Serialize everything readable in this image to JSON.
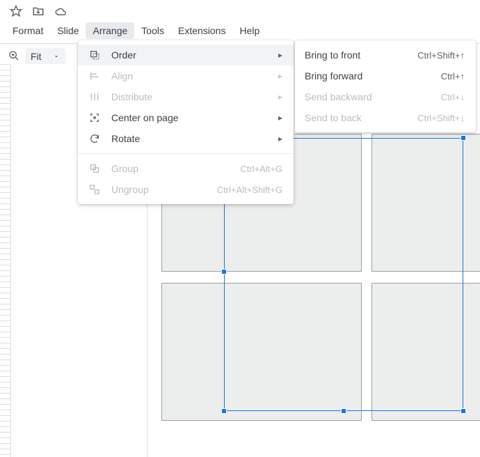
{
  "title_icons": [
    "star",
    "move-to-folder",
    "cloud"
  ],
  "menubar": {
    "items": [
      "Format",
      "Slide",
      "Arrange",
      "Tools",
      "Extensions",
      "Help"
    ],
    "open_index": 2
  },
  "toolbar": {
    "zoom_label": "Fit"
  },
  "arrange_menu": {
    "items": [
      {
        "icon": "order",
        "label": "Order",
        "submenu": true,
        "enabled": true,
        "hover": true
      },
      {
        "icon": "align",
        "label": "Align",
        "submenu": true,
        "enabled": false
      },
      {
        "icon": "distribute",
        "label": "Distribute",
        "submenu": true,
        "enabled": false
      },
      {
        "icon": "center",
        "label": "Center on page",
        "submenu": true,
        "enabled": true
      },
      {
        "icon": "rotate",
        "label": "Rotate",
        "submenu": true,
        "enabled": true
      },
      {
        "separator": true
      },
      {
        "icon": "group",
        "label": "Group",
        "kbd": "Ctrl+Alt+G",
        "enabled": false
      },
      {
        "icon": "ungroup",
        "label": "Ungroup",
        "kbd": "Ctrl+Alt+Shift+G",
        "enabled": false
      }
    ]
  },
  "order_submenu": {
    "items": [
      {
        "label": "Bring to front",
        "kbd": "Ctrl+Shift+↑",
        "enabled": true,
        "highlighted": true
      },
      {
        "label": "Bring forward",
        "kbd": "Ctrl+↑",
        "enabled": true
      },
      {
        "label": "Send backward",
        "kbd": "Ctrl+↓",
        "enabled": false
      },
      {
        "label": "Send to back",
        "kbd": "Ctrl+Shift+↓",
        "enabled": false
      }
    ]
  }
}
